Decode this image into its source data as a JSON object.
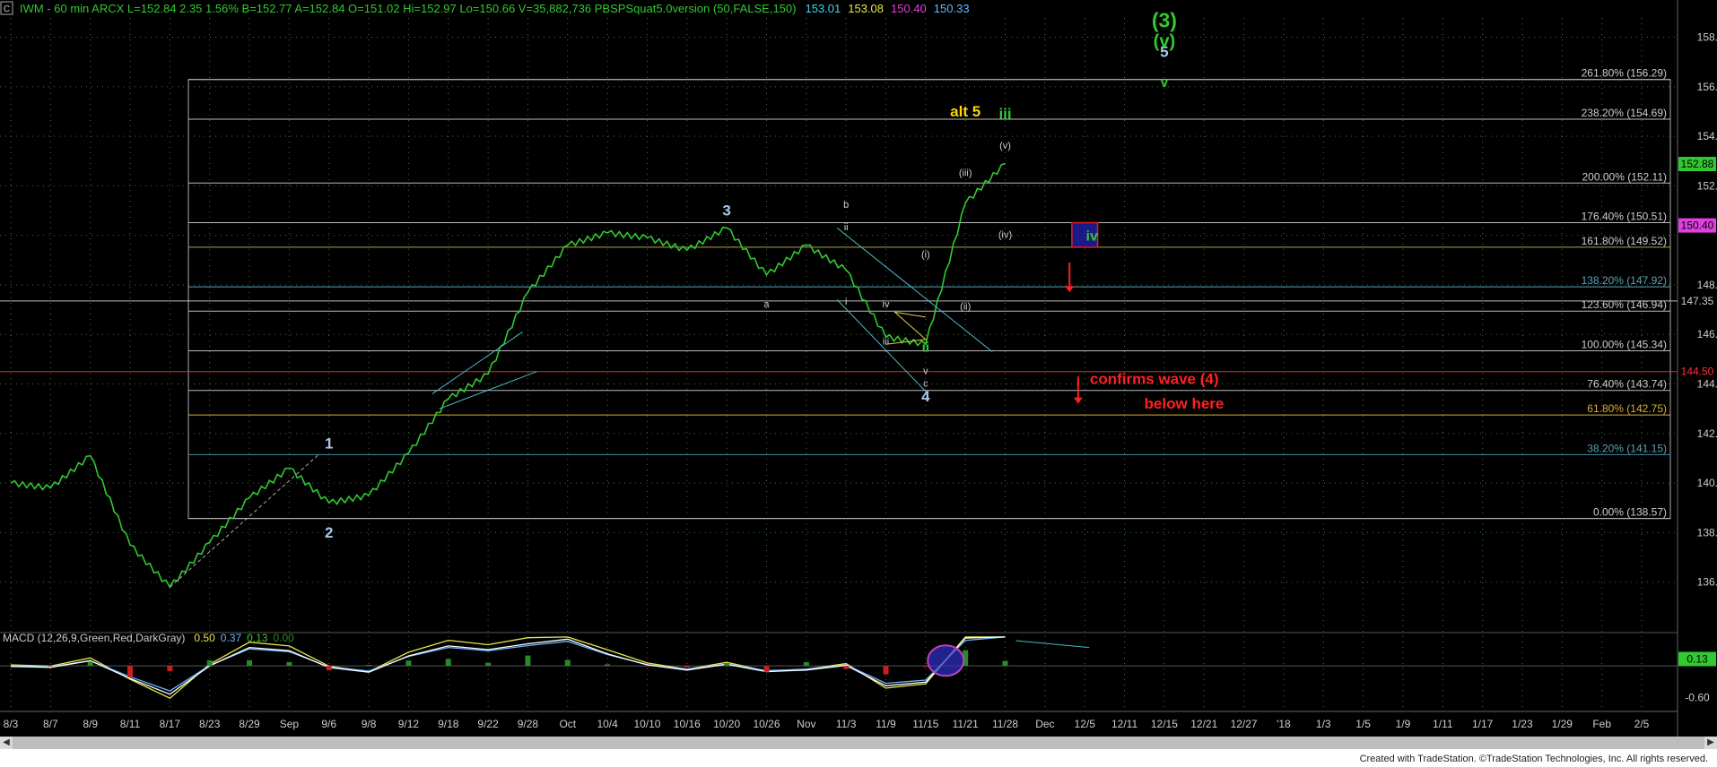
{
  "header": {
    "symbol_box": "C",
    "text": "IWM - 60 min  ARCX  L=152.84  2.35  1.56%  B=152.77  A=152.84  O=151.02  Hi=152.97  Lo=150.66  V=35,882,736  PBSPSquat5.0version (50,FALSE,150)",
    "values": [
      {
        "text": "153.01",
        "color": "#3fd3e8"
      },
      {
        "text": "153.08",
        "color": "#e8e84a"
      },
      {
        "text": "150.40",
        "color": "#e040e0"
      },
      {
        "text": "150.33",
        "color": "#6ab4ff"
      }
    ]
  },
  "macd_header": {
    "text": "MACD (12,26,9,Green,Red,DarkGray)",
    "values": [
      {
        "text": "0.50",
        "color": "#e8e84a"
      },
      {
        "text": "0.37",
        "color": "#6ab4ff"
      },
      {
        "text": "0.13",
        "color": "#32c832"
      },
      {
        "text": "0.00",
        "color": "#2a8a2a"
      }
    ]
  },
  "chart_data": {
    "type": "line",
    "title": "IWM - 60 min",
    "ylim": [
      134.0,
      159.5
    ],
    "y_ticks": [
      136,
      138,
      140,
      142,
      144,
      146,
      148,
      150,
      152,
      154,
      156,
      158
    ],
    "y_tick_labels": [
      "136.00",
      "138.00",
      "140.00",
      "142.00",
      "144.00",
      "146.00",
      "148.00",
      "",
      "152.00",
      "154.00",
      "156.00",
      "158.00"
    ],
    "x_ticks": [
      "8/3",
      "8/7",
      "8/9",
      "8/11",
      "8/17",
      "8/23",
      "8/29",
      "Sep",
      "9/6",
      "9/8",
      "9/12",
      "9/18",
      "9/22",
      "9/28",
      "Oct",
      "10/4",
      "10/10",
      "10/16",
      "10/20",
      "10/26",
      "Nov",
      "11/3",
      "11/9",
      "11/15",
      "11/21",
      "11/28",
      "Dec",
      "12/5",
      "12/11",
      "12/15",
      "12/21",
      "12/27",
      "'18",
      "1/3",
      "1/5",
      "1/9",
      "1/11",
      "1/17",
      "1/23",
      "1/29",
      "Feb",
      "2/5"
    ],
    "series": [
      {
        "name": "IWM",
        "color": "#32c832",
        "points": [
          [
            "8/3",
            140.0
          ],
          [
            "8/7",
            139.8
          ],
          [
            "8/9",
            141.1
          ],
          [
            "8/11",
            137.5
          ],
          [
            "8/17",
            135.8
          ],
          [
            "8/23",
            137.6
          ],
          [
            "8/29",
            139.4
          ],
          [
            "Sep",
            140.6
          ],
          [
            "9/6",
            139.2
          ],
          [
            "9/8",
            139.5
          ],
          [
            "9/12",
            141.2
          ],
          [
            "9/18",
            143.4
          ],
          [
            "9/22",
            144.4
          ],
          [
            "9/28",
            147.7
          ],
          [
            "Oct",
            149.6
          ],
          [
            "10/4",
            150.1
          ],
          [
            "10/10",
            149.9
          ],
          [
            "10/16",
            149.4
          ],
          [
            "10/20",
            150.3
          ],
          [
            "10/26",
            148.4
          ],
          [
            "Nov",
            149.6
          ],
          [
            "11/3",
            148.6
          ],
          [
            "11/9",
            145.9
          ],
          [
            "11/15",
            145.6
          ],
          [
            "11/21",
            151.3
          ],
          [
            "11/28",
            152.9
          ]
        ]
      }
    ],
    "fib_levels": [
      {
        "pct": "261.80%",
        "value": 156.29
      },
      {
        "pct": "238.20%",
        "value": 154.69
      },
      {
        "pct": "200.00%",
        "value": 152.11
      },
      {
        "pct": "176.40%",
        "value": 150.51
      },
      {
        "pct": "161.80%",
        "value": 149.52
      },
      {
        "pct": "138.20%",
        "value": 147.92
      },
      {
        "pct": "123.60%",
        "value": 146.94
      },
      {
        "pct": "100.00%",
        "value": 145.34
      },
      {
        "pct": "76.40%",
        "value": 143.74
      },
      {
        "pct": "61.80%",
        "value": 142.75
      },
      {
        "pct": "38.20%",
        "value": 141.15
      },
      {
        "pct": "0.00%",
        "value": 138.57
      }
    ],
    "price_markers": [
      {
        "text": "152.88",
        "value": 152.88,
        "bg": "#32c832",
        "fg": "#000000"
      },
      {
        "text": "150.40",
        "value": 150.4,
        "bg": "#e040e0",
        "fg": "#000000"
      },
      {
        "text": "147.35",
        "value": 147.35,
        "bg": "",
        "fg": "#cccccc"
      },
      {
        "text": "144.50",
        "value": 144.5,
        "bg": "",
        "fg": "#ff3030"
      }
    ],
    "red_line": 144.5,
    "white_line": 147.35,
    "wave_labels": [
      {
        "text": "1",
        "x": "9/6",
        "y": 141.4,
        "color": "#a9c8e8",
        "size": 17
      },
      {
        "text": "2",
        "x": "9/6",
        "y": 137.8,
        "color": "#a9c8e8",
        "size": 17
      },
      {
        "text": "3",
        "x": "10/20",
        "y": 150.8,
        "color": "#a9c8e8",
        "size": 17
      },
      {
        "text": "4",
        "x": "11/15",
        "y": 143.3,
        "color": "#a9c8e8",
        "size": 17
      },
      {
        "text": "5",
        "x": "12/15",
        "y": 157.2,
        "color": "#a9c8e8",
        "size": 17
      },
      {
        "text": "(3)",
        "x": "12/15",
        "y": 158.4,
        "color": "#32c832",
        "size": 23
      },
      {
        "text": "(v)",
        "x": "12/15",
        "y": 157.6,
        "color": "#32c832",
        "size": 20
      },
      {
        "text": "v",
        "x": "12/15",
        "y": 156.0,
        "color": "#32c832",
        "size": 15
      },
      {
        "text": "alt 5",
        "x": "11/21",
        "y": 154.8,
        "color": "#ffd700",
        "size": 17
      },
      {
        "text": "iii",
        "x": "11/28",
        "y": 154.7,
        "color": "#32c832",
        "size": 17
      },
      {
        "text": "ii",
        "x": "11/15",
        "y": 145.3,
        "color": "#32c832",
        "size": 15
      },
      {
        "text": "(v)",
        "x": "11/28",
        "y": 153.5,
        "color": "#cccccc",
        "size": 11
      },
      {
        "text": "(iii)",
        "x": "11/21",
        "y": 152.4,
        "color": "#cccccc",
        "size": 11
      },
      {
        "text": "(iv)",
        "x": "11/28",
        "y": 149.9,
        "color": "#cccccc",
        "size": 11
      },
      {
        "text": "(i)",
        "x": "11/15",
        "y": 149.1,
        "color": "#cccccc",
        "size": 11
      },
      {
        "text": "(ii)",
        "x": "11/21",
        "y": 147.0,
        "color": "#cccccc",
        "size": 11
      },
      {
        "text": "a",
        "x": "10/26",
        "y": 147.1,
        "color": "#cccccc",
        "size": 11
      },
      {
        "text": "b",
        "x": "11/3",
        "y": 151.1,
        "color": "#cccccc",
        "size": 11
      },
      {
        "text": "c",
        "x": "11/15",
        "y": 143.9,
        "color": "#cccccc",
        "size": 11
      },
      {
        "text": "i",
        "x": "11/3",
        "y": 147.2,
        "color": "#cccccc",
        "size": 11
      },
      {
        "text": "ii",
        "x": "11/3",
        "y": 150.2,
        "color": "#cccccc",
        "size": 11
      },
      {
        "text": "iii",
        "x": "11/9",
        "y": 145.6,
        "color": "#cccccc",
        "size": 11
      },
      {
        "text": "iv",
        "x": "11/9",
        "y": 147.1,
        "color": "#cccccc",
        "size": 11
      },
      {
        "text": "v",
        "x": "11/15",
        "y": 144.4,
        "color": "#cccccc",
        "size": 11
      }
    ],
    "annotations": {
      "confirm_line1": "confirms wave (4)",
      "confirm_line2": "below here",
      "box_label": "iv"
    },
    "macd": {
      "ylim": [
        -0.8,
        0.6
      ],
      "y_tick_labels": [
        "0.13",
        "-0.60"
      ],
      "marker": {
        "text": "0.13",
        "value": 0.13,
        "bg": "#32c832"
      }
    }
  },
  "footer": "Created with TradeStation. ©TradeStation Technologies, Inc. All rights reserved."
}
